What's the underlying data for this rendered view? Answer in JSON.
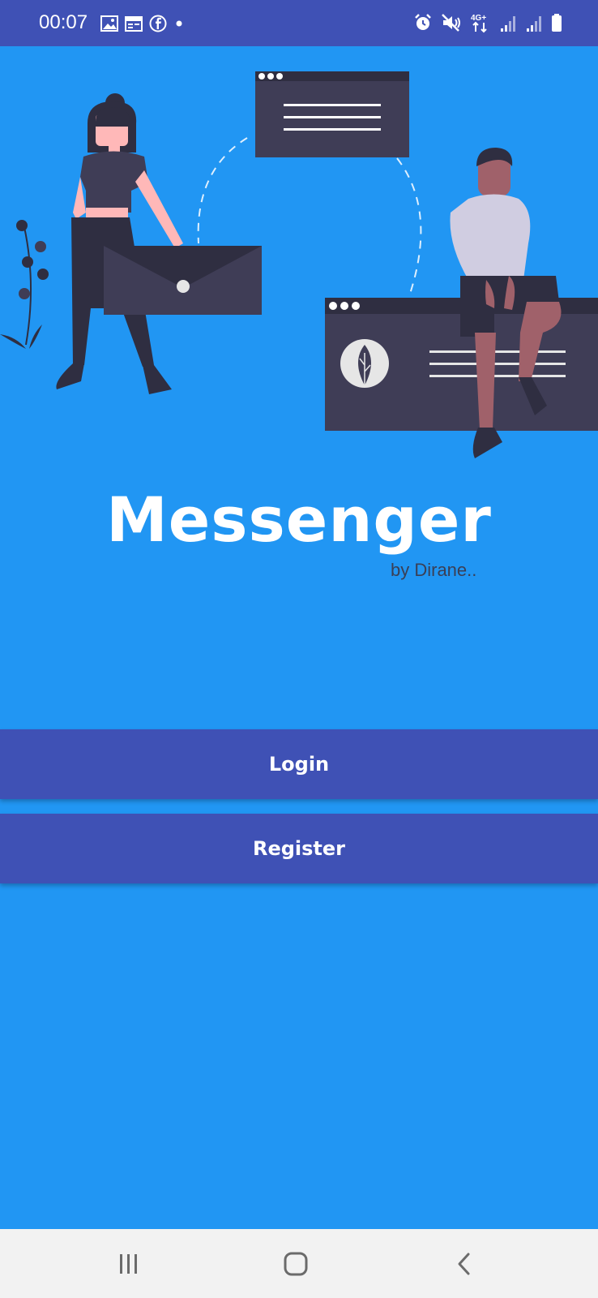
{
  "status_bar": {
    "time": "00:07",
    "left_icons": [
      "image-icon",
      "calendar-icon",
      "facebook-icon",
      "dot-icon"
    ],
    "right_icons": [
      "alarm-icon",
      "mute-icon",
      "4g-icon",
      "signal-icon",
      "signal-icon",
      "battery-icon"
    ],
    "network_label": "4G+"
  },
  "app": {
    "title": "Messenger",
    "subtitle": "by Dirane.."
  },
  "buttons": {
    "login_label": "Login",
    "register_label": "Register"
  },
  "navigation": {
    "recents_icon": "recents-icon",
    "home_icon": "home-icon",
    "back_icon": "back-icon"
  },
  "colors": {
    "background": "#2196F3",
    "primary": "#3F51B5",
    "nav_bar": "#F2F2F2"
  }
}
